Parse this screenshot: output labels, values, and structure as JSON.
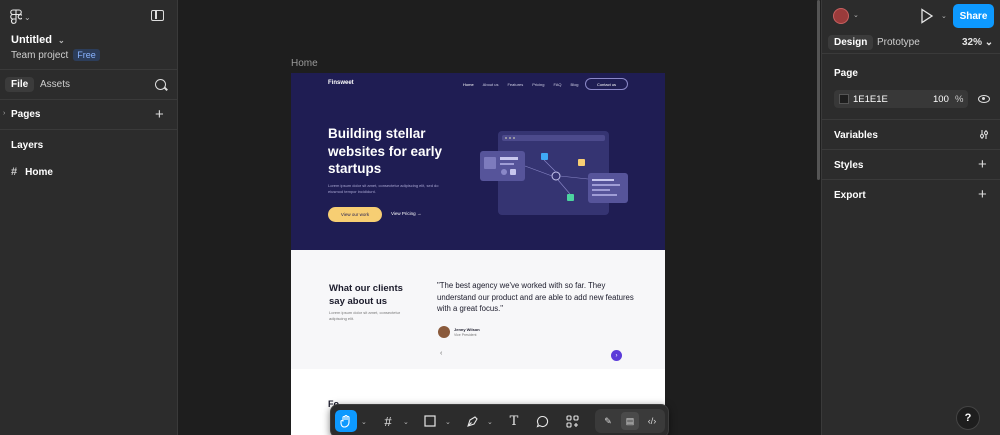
{
  "file": {
    "title": "Untitled",
    "project": "Team project",
    "plan_badge": "Free"
  },
  "left_tabs": {
    "file": "File",
    "assets": "Assets"
  },
  "pages": {
    "label": "Pages"
  },
  "layers": {
    "label": "Layers",
    "items": [
      {
        "name": "Home",
        "icon": "frame-icon"
      }
    ]
  },
  "canvas": {
    "frame_label": "Home",
    "page_background": "#1E1E1E"
  },
  "site": {
    "brand": "Finsweet",
    "nav": [
      "Home",
      "About us",
      "Features",
      "Pricing",
      "FAQ",
      "Blog"
    ],
    "contact_button": "Contact us",
    "hero_title": "Building stellar websites for early startups",
    "hero_subtitle": "Lorem ipsum dolor sit amet, consectetur adipiscing elit, sed do eiusmod tempor incididunt.",
    "cta_primary": "View our work",
    "cta_secondary": "View Pricing",
    "testimonials_title": "What our clients say about us",
    "testimonials_subtitle": "Lorem ipsum dolor sit amet, consectetur adipiscing elit.",
    "quote": "\"The best agency we've worked with so far. They understand our product and are able to add new features with a great focus.\"",
    "author_name": "Jenny Wilson",
    "author_role": "Vice President",
    "prev_arrow": "‹",
    "next_arrow": "›",
    "section3_peek": "Fo"
  },
  "toolbar": {
    "tools": [
      "hand-tool",
      "frame-tool",
      "shape-tool",
      "pen-tool",
      "text-tool",
      "comment-tool",
      "actions-tool"
    ],
    "active": "hand-tool",
    "modes": [
      "draw-mode",
      "design-mode",
      "dev-mode"
    ],
    "active_mode": "design-mode"
  },
  "right_panel": {
    "share_label": "Share",
    "tabs": {
      "design": "Design",
      "prototype": "Prototype"
    },
    "zoom": "32%",
    "page_section": "Page",
    "page_color_hex": "1E1E1E",
    "page_opacity": "100",
    "page_opacity_unit": "%",
    "variables_label": "Variables",
    "styles_label": "Styles",
    "export_label": "Export",
    "help_label": "?"
  },
  "colors": {
    "accent": "#0d99ff",
    "hero_bg": "#1f1d53",
    "cta_yellow": "#f7ce73",
    "purple_accent": "#5b3bd9"
  }
}
